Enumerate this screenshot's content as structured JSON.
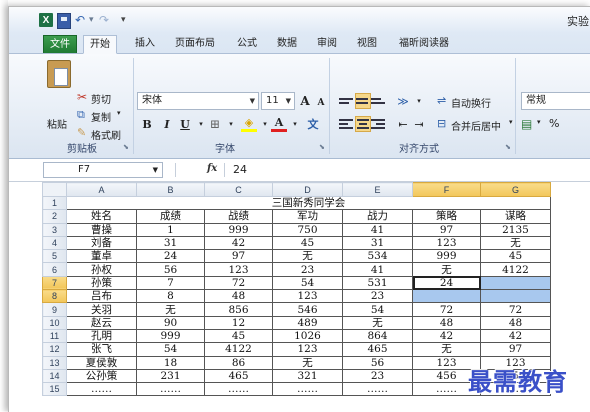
{
  "window": {
    "title": "实验"
  },
  "quick_access": {
    "logo": "X",
    "undo": "↶",
    "redo": "↷",
    "more": "▾"
  },
  "tabs": [
    {
      "label": "文件"
    },
    {
      "label": "开始"
    },
    {
      "label": "插入"
    },
    {
      "label": "页面布局"
    },
    {
      "label": "公式"
    },
    {
      "label": "数据"
    },
    {
      "label": "审阅"
    },
    {
      "label": "视图"
    },
    {
      "label": "福昕阅读器"
    }
  ],
  "clipboard": {
    "paste": "粘贴",
    "cut": "剪切",
    "copy": "复制",
    "copy_arrow": "▾",
    "format_painter": "格式刷",
    "group": "剪贴板"
  },
  "font": {
    "name": "宋体",
    "size": "11",
    "bold": "B",
    "italic": "I",
    "underline": "U",
    "grow": "A",
    "shrink": "A",
    "phonetic": "文",
    "group": "字体"
  },
  "alignment": {
    "wrap_text": "自动换行",
    "merge_center": "合并后居中",
    "group": "对齐方式"
  },
  "number": {
    "format": "常规"
  },
  "formula_bar": {
    "cell_ref": "F7",
    "fx": "fx",
    "value": "24"
  },
  "columns": [
    "A",
    "B",
    "C",
    "D",
    "E",
    "F",
    "G"
  ],
  "rows": [
    {
      "n": "1",
      "cells": [
        "三国新秀同学会"
      ]
    },
    {
      "n": "2",
      "cells": [
        "姓名",
        "成绩",
        "战绩",
        "军功",
        "战力",
        "策略",
        "谋略"
      ]
    },
    {
      "n": "3",
      "cells": [
        "曹操",
        "1",
        "999",
        "750",
        "41",
        "97",
        "2135"
      ]
    },
    {
      "n": "4",
      "cells": [
        "刘备",
        "31",
        "42",
        "45",
        "31",
        "123",
        "无"
      ]
    },
    {
      "n": "5",
      "cells": [
        "董卓",
        "24",
        "97",
        "无",
        "534",
        "999",
        "45"
      ]
    },
    {
      "n": "6",
      "cells": [
        "孙权",
        "56",
        "123",
        "23",
        "41",
        "无",
        "4122"
      ]
    },
    {
      "n": "7",
      "cells": [
        "孙策",
        "7",
        "72",
        "54",
        "531",
        "24",
        ""
      ]
    },
    {
      "n": "8",
      "cells": [
        "吕布",
        "8",
        "48",
        "123",
        "23",
        "",
        ""
      ]
    },
    {
      "n": "9",
      "cells": [
        "关羽",
        "无",
        "856",
        "546",
        "54",
        "72",
        "72"
      ]
    },
    {
      "n": "10",
      "cells": [
        "赵云",
        "90",
        "12",
        "489",
        "无",
        "48",
        "48"
      ]
    },
    {
      "n": "11",
      "cells": [
        "孔明",
        "999",
        "45",
        "1026",
        "864",
        "42",
        "42"
      ]
    },
    {
      "n": "12",
      "cells": [
        "张飞",
        "54",
        "4122",
        "123",
        "465",
        "无",
        "97"
      ]
    },
    {
      "n": "13",
      "cells": [
        "夏侯敦",
        "18",
        "86",
        "无",
        "56",
        "123",
        "123"
      ]
    },
    {
      "n": "14",
      "cells": [
        "公孙策",
        "231",
        "465",
        "321",
        "23",
        "456",
        "456"
      ]
    },
    {
      "n": "15",
      "cells": [
        "……",
        "……",
        "……",
        "……",
        "……",
        "……",
        "……"
      ]
    }
  ],
  "selection": {
    "range": "F7:G8",
    "active": "F7"
  },
  "watermark": "最需教育"
}
